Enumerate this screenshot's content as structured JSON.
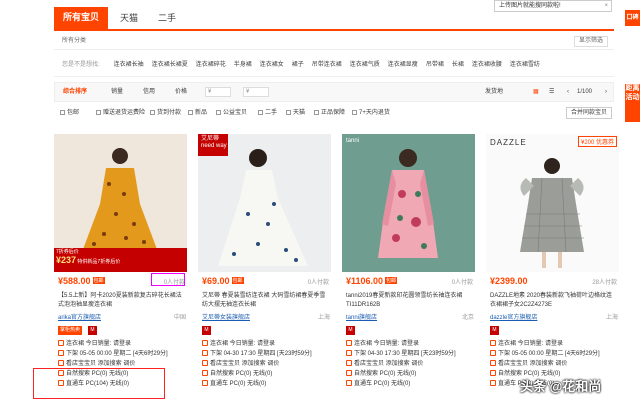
{
  "tabs": [
    "所有宝贝",
    "天猫",
    "二手"
  ],
  "popup": {
    "text": "上传图片就能搜同款啦!",
    "close": "×"
  },
  "side": {
    "top": "口碑",
    "mid": "距离活动"
  },
  "category": {
    "label": "所有分类",
    "filter": "显示筛选"
  },
  "keywords": {
    "label": "您是不是想找:",
    "items": [
      "连衣裙长袖",
      "连衣裙长裙夏",
      "连衣裙碎花",
      "半身裙",
      "连衣裙女",
      "裙子",
      "吊带连衣裙",
      "连衣裙气质",
      "连衣裙显瘦",
      "吊带裙",
      "长裙",
      "连衣裙收腰",
      "连衣裙雪纺"
    ]
  },
  "sort": {
    "items": [
      "综合排序",
      "销量",
      "信用",
      "价格",
      "发货地"
    ],
    "price_from": "¥",
    "price_to": "¥",
    "page": "1/100"
  },
  "filters": {
    "items": [
      "包邮",
      "赠送退货运费险",
      "货到付款",
      "新品",
      "公益宝贝",
      "二手",
      "天猫",
      "正品保障",
      "7+天内退货"
    ],
    "button": "合并同款宝贝"
  },
  "cards": [
    {
      "price": "¥588.00",
      "tag": "包邮",
      "paid": "0人付款",
      "title": "【5.5上新】阿卡2020夏装新款复古碎花长裙法式泡泡袖显瘦连衣裙",
      "shop": "arika官方旗舰店",
      "loc": "中国",
      "badge": "掌柜热卖",
      "l1": "连衣裙 今日销量: 请登录",
      "l2": "下架 05-05 00:00 星期二 [4天6时29分]",
      "l3": "看店宝宝贝 添加搜索 调价",
      "l4": "自然搜索 PC(0) 无线(0)",
      "l5": "直通车 PC(104) 无线(0)",
      "promo1": "7折券后价",
      "promo2": "¥237",
      "promo3": "特供新品7折券后价"
    },
    {
      "price": "¥69.00",
      "tag": "包邮",
      "paid": "0人付款",
      "title": "艾尼蒂 春夏装雪纺连衣裙 大码雪纺裙春夏季雪纺大摆无袖连衣长裙",
      "shop": "艾尼蒂女装旗舰店",
      "loc": "上海",
      "badge": "",
      "l1": "连衣裙 今日销量: 请登录",
      "l2": "下架 04-30 17:30 星期四 [天23时59分]",
      "l3": "看店宝宝贝 添加搜索 调价",
      "l4": "自然搜索 PC(0) 无线(0)",
      "l5": "直通车 PC(0) 无线(0)",
      "brand": "艾尼蒂",
      "brand2": "need way"
    },
    {
      "price": "¥1106.00",
      "tag": "包邮",
      "paid": "0人付款",
      "title": "tanni2019春夏新款印花圆领雪纺长袖连衣裙TI11DR162B",
      "shop": "tanni旗舰店",
      "loc": "北京",
      "badge": "",
      "l1": "连衣裙 今日销量: 请登录",
      "l2": "下架 04-30 17:30 星期四 [天23时59分]",
      "l3": "看店宝宝贝 添加搜索 调价",
      "l4": "自然搜索 PC(0) 无线(0)",
      "l5": "直通车 PC(0) 无线(0)",
      "brand": "tanni"
    },
    {
      "price": "¥2399.00",
      "tag": "",
      "paid": "28人付款",
      "title": "DAZZLE地素 2020春装新款飞袖荷叶边格纹连衣裙裙子女2C2Z4273E",
      "shop": "dazzle官方旗舰店",
      "loc": "上海",
      "badge": "",
      "l1": "连衣裙 今日销量: 请登录",
      "l2": "下架 05-05 00:00 星期二 [4天6时29分]",
      "l3": "看店宝宝贝 添加搜索 调价",
      "l4": "自然搜索 PC(0) 无线(0)",
      "l5": "直通车 PC(0) 无线(0)",
      "brand": "DAZZLE",
      "promo": "¥200 优惠券"
    }
  ],
  "watermark": "头条 @花和尚"
}
